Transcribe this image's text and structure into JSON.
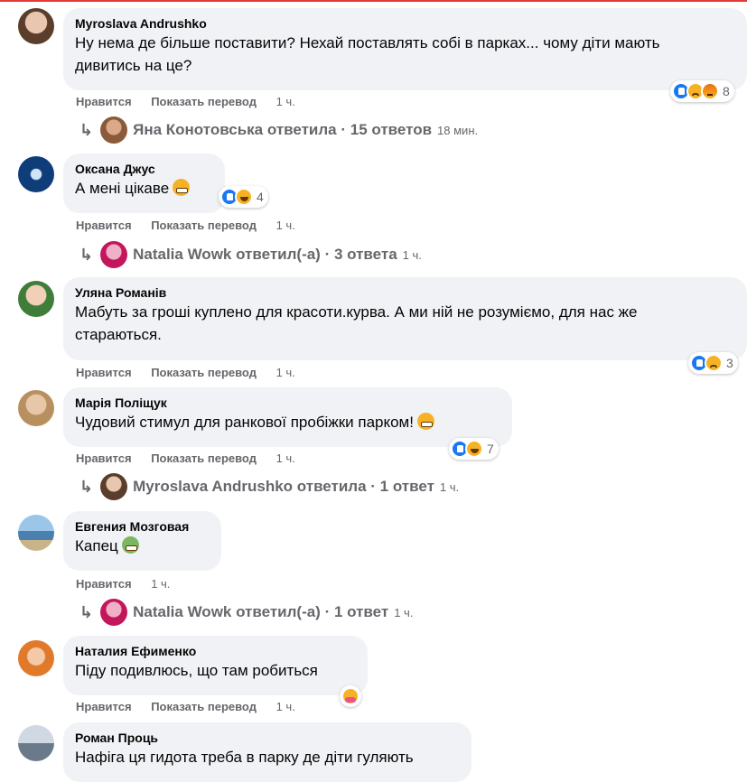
{
  "actions": {
    "like": "Нравится",
    "translate": "Показать перевод"
  },
  "comments": [
    {
      "author": "Myroslava Andrushko",
      "text_lines": [
        "Ну нема де більше поставити? Нехай поставлять собі в парках... чому діти мають",
        "дивитись на це?"
      ],
      "time": "1 ч.",
      "reactions": [
        "like-icon",
        "sad-icon",
        "angry-icon"
      ],
      "reaction_count": "8",
      "reply": {
        "author": "Яна Конотовська",
        "summary": "Яна Конотовська ответила · 15 ответов",
        "time": "18 мин."
      }
    },
    {
      "author": "Оксана Джус",
      "text_lines": [
        "А мені цікаве"
      ],
      "emoji": "grin-emoji",
      "time": "1 ч.",
      "reactions": [
        "like-icon",
        "haha-icon"
      ],
      "reaction_count": "4",
      "reply": {
        "author": "Natalia Wowk",
        "summary": "Natalia Wowk ответил(-а) · 3 ответа",
        "time": "1 ч."
      }
    },
    {
      "author": "Уляна Романів",
      "text_lines": [
        "Мабуть за гроші куплено для красоти.курва. А ми ній не розуміємо, для нас же",
        "стараються."
      ],
      "time": "1 ч.",
      "reactions": [
        "like-icon",
        "sad-icon"
      ],
      "reaction_count": "3"
    },
    {
      "author": "Марія Поліщук",
      "text_lines": [
        "Чудовий стимул для ранкової пробіжки парком!"
      ],
      "emoji": "grin-emoji",
      "time": "1 ч.",
      "reactions": [
        "like-icon",
        "haha-icon"
      ],
      "reaction_count": "7",
      "reply": {
        "author": "Myroslava Andrushko",
        "summary": "Myroslava Andrushko ответила · 1 ответ",
        "time": "1 ч."
      }
    },
    {
      "author": "Евгения Мозговая",
      "text_lines": [
        "Капец"
      ],
      "emoji": "sick-emoji",
      "time": "1 ч.",
      "reply": {
        "author": "Natalia Wowk",
        "summary": "Natalia Wowk ответил(-а) · 1 ответ",
        "time": "1 ч."
      }
    },
    {
      "author": "Наталия Ефименко",
      "text_lines": [
        "Піду подивлюсь, що там робиться"
      ],
      "time": "1 ч.",
      "reactions": [
        "care-icon"
      ]
    },
    {
      "author": "Роман Проць",
      "text_lines": [
        "Нафіга ця гидота треба в парку де діти гуляють"
      ]
    }
  ]
}
